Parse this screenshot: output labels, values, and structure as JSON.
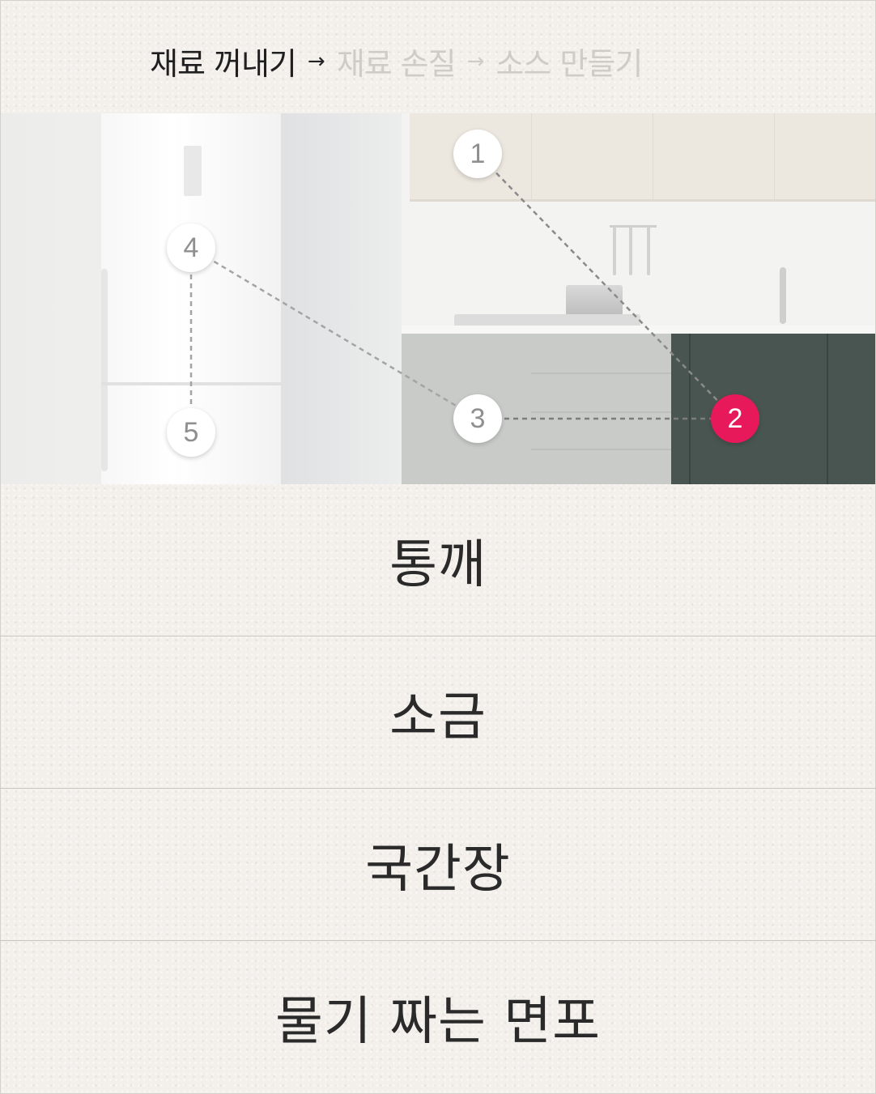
{
  "steps": {
    "items": [
      {
        "label": "재료 꺼내기",
        "state": "active"
      },
      {
        "label": "재료 손질",
        "state": "inactive"
      },
      {
        "label": "소스 만들기",
        "state": "inactive"
      }
    ],
    "separator": "→"
  },
  "scene": {
    "markers": [
      {
        "label": "1",
        "state": "inactive"
      },
      {
        "label": "2",
        "state": "active"
      },
      {
        "label": "3",
        "state": "inactive"
      },
      {
        "label": "4",
        "state": "inactive"
      },
      {
        "label": "5",
        "state": "inactive"
      }
    ],
    "active_color": "#e8195a"
  },
  "ingredients": [
    {
      "label": "통깨"
    },
    {
      "label": "소금"
    },
    {
      "label": "국간장"
    },
    {
      "label": "물기 짜는 면포"
    }
  ]
}
